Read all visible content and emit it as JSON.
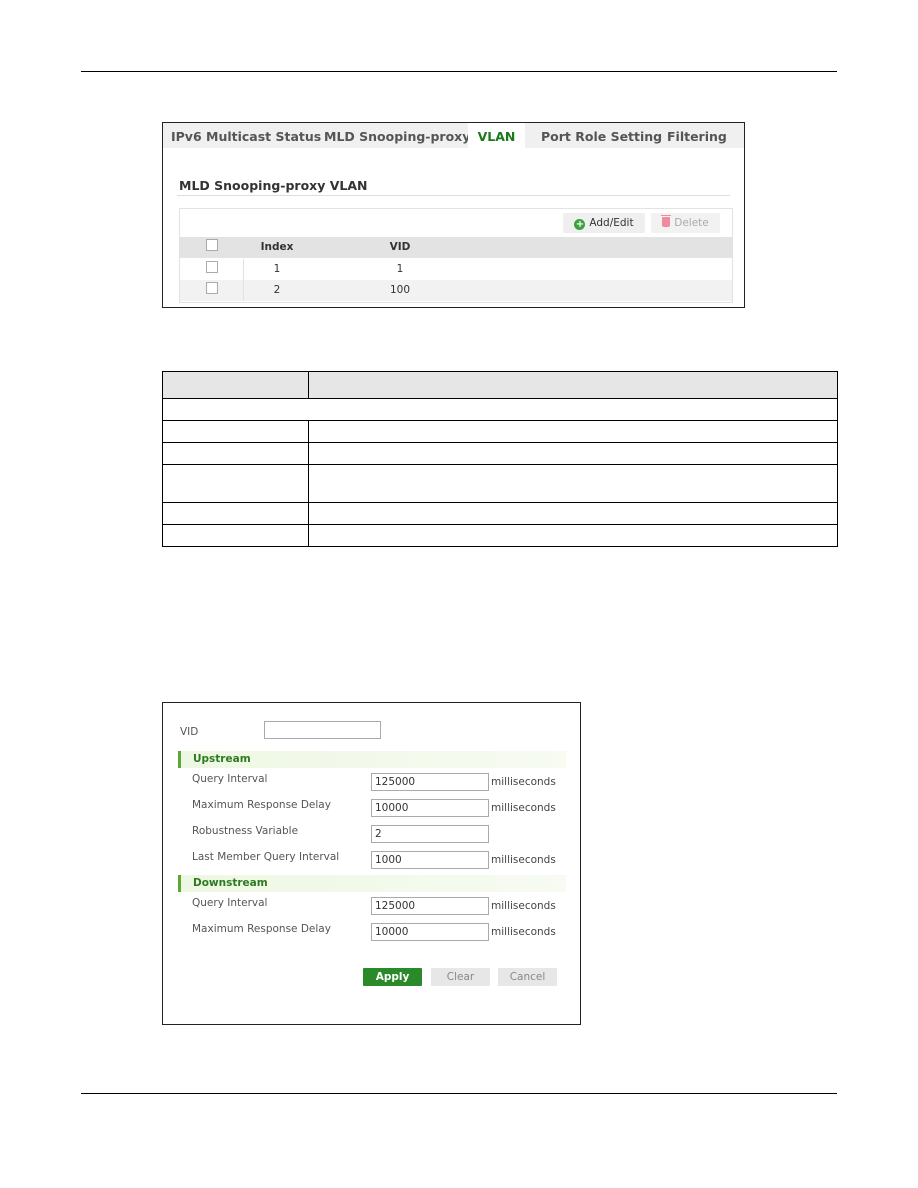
{
  "vlan_screen": {
    "tabs": [
      {
        "label": "IPv6 Multicast Status",
        "active": false
      },
      {
        "label": "MLD Snooping-proxy",
        "active": false
      },
      {
        "label": "VLAN",
        "active": true
      },
      {
        "label": "Port Role Setting",
        "active": false
      },
      {
        "label": "Filtering",
        "active": false
      }
    ],
    "section_title": "MLD Snooping-proxy VLAN",
    "toolbar": {
      "add_edit_label": "Add/Edit",
      "add_edit_icon": "plus-circle-icon",
      "delete_label": "Delete",
      "delete_icon": "trash-icon",
      "delete_enabled": false
    },
    "table": {
      "columns": [
        "",
        "Index",
        "VID"
      ],
      "rows": [
        {
          "checked": false,
          "index": "1",
          "vid": "1"
        },
        {
          "checked": false,
          "index": "2",
          "vid": "100"
        }
      ]
    }
  },
  "reference_table": {
    "rows": 7
  },
  "edit_form": {
    "vid": {
      "label": "VID",
      "value": ""
    },
    "upstream": {
      "title": "Upstream",
      "query_interval": {
        "label": "Query Interval",
        "value": "125000",
        "unit": "milliseconds"
      },
      "max_response_delay": {
        "label": "Maximum Response Delay",
        "value": "10000",
        "unit": "milliseconds"
      },
      "robustness_variable": {
        "label": "Robustness Variable",
        "value": "2"
      },
      "last_member_query_interval": {
        "label": "Last Member Query Interval",
        "value": "1000",
        "unit": "milliseconds"
      }
    },
    "downstream": {
      "title": "Downstream",
      "query_interval": {
        "label": "Query Interval",
        "value": "125000",
        "unit": "milliseconds"
      },
      "max_response_delay": {
        "label": "Maximum Response Delay",
        "value": "10000",
        "unit": "milliseconds"
      }
    },
    "buttons": {
      "apply": "Apply",
      "clear": "Clear",
      "cancel": "Cancel"
    }
  },
  "colors": {
    "accent_green": "#1b7a1b",
    "apply_button": "#2a8a2a",
    "section_bar": "#5aa932"
  }
}
